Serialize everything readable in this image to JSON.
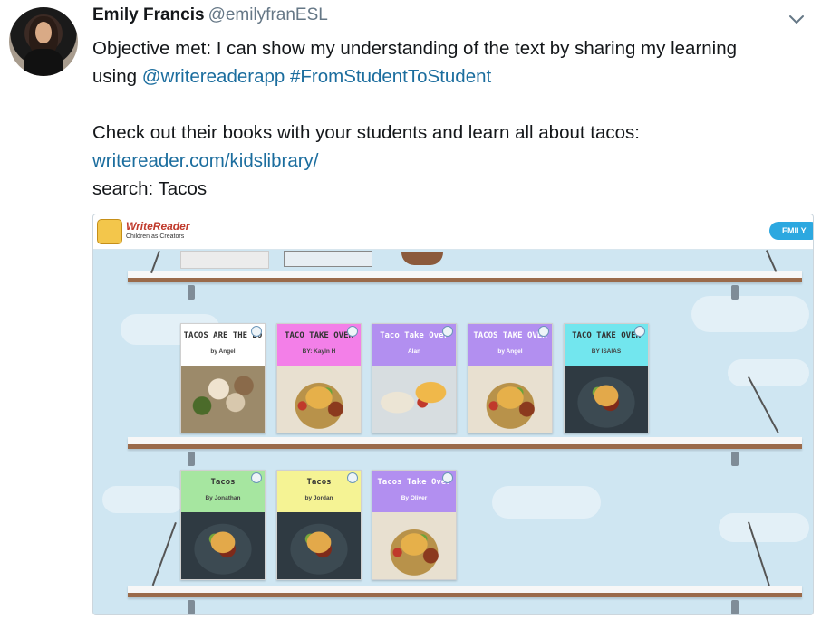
{
  "tweet": {
    "author_name": "Emily Francis",
    "author_handle": "@emilyfranESL",
    "line1": "Objective met: I can show my understanding of the text by sharing my learning",
    "line2_prefix": "using ",
    "mention": "@writereaderapp",
    "hashtag": "#FromStudentToStudent",
    "line3": "Check out their books with your students and learn all about tacos:",
    "link": "writereader.com/kidslibrary/",
    "line4": "search: Tacos"
  },
  "card": {
    "logo_title": "WriteReader",
    "logo_subtitle": "Children as Creators",
    "user_button": "EMILY",
    "shelf1_books": [
      {
        "title": "TACOS ARE THE BO",
        "author": "by Angel",
        "color": "#ffffff",
        "photo": "mushroom"
      },
      {
        "title": "TACO TAKE OVER",
        "author": "BY: Kayln H",
        "color": "#f37fe8",
        "photo": "taco"
      },
      {
        "title": "Taco Take Over",
        "author": "Alan",
        "color": "#b28ff0",
        "photo": "plate"
      },
      {
        "title": "TACOS TAKE OVER",
        "author": "by Angel",
        "color": "#b28ff0",
        "photo": "taco"
      },
      {
        "title": "TACO TAKE OVER",
        "author": "BY ISAIAS",
        "color": "#72e6ee",
        "photo": "dark"
      }
    ],
    "shelf2_books": [
      {
        "title": "Tacos",
        "author": "By Jonathan",
        "color": "#a6e6a0",
        "photo": "dark"
      },
      {
        "title": "Tacos",
        "author": "by Jordan",
        "color": "#f5f394",
        "photo": "dark"
      },
      {
        "title": "Tacos Take Over",
        "author": "By Oliver",
        "color": "#b28ff0",
        "photo": "taco"
      }
    ]
  },
  "icons": {
    "chevron": "chevron-down-icon",
    "globe": "globe-icon"
  },
  "colors": {
    "link": "#1b6d9e",
    "handle": "#657786",
    "card_bg": "#cfe6f2",
    "shelf_edge": "#9a6a4a"
  }
}
